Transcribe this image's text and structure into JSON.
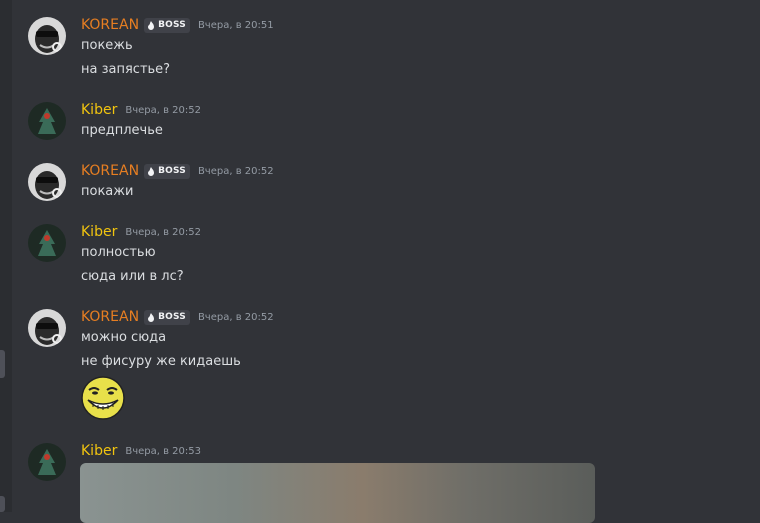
{
  "messages": [
    {
      "author": "KOREAN",
      "tag": "BOSS",
      "timestamp": "Вчера, в 20:51",
      "lines": [
        "покежь",
        "на запястье?"
      ]
    },
    {
      "author": "Kiber",
      "timestamp": "Вчера, в 20:52",
      "lines": [
        "предплечье"
      ]
    },
    {
      "author": "KOREAN",
      "tag": "BOSS",
      "timestamp": "Вчера, в 20:52",
      "lines": [
        "покажи"
      ]
    },
    {
      "author": "Kiber",
      "timestamp": "Вчера, в 20:52",
      "lines": [
        "полностью",
        "сюда или в лс?"
      ]
    },
    {
      "author": "KOREAN",
      "tag": "BOSS",
      "timestamp": "Вчера, в 20:52",
      "lines": [
        "можно сюда",
        "не фисуру же кидаешь"
      ],
      "emoji": "trollface-emoji"
    },
    {
      "author": "Kiber",
      "timestamp": "Вчера, в 20:53",
      "attachment": "image-attachment"
    }
  ],
  "colors": {
    "background": "#313338",
    "korean_name": "#e67e22",
    "kiber_name": "#f1c40f",
    "text": "#dbdee1",
    "timestamp": "#949ba4"
  }
}
